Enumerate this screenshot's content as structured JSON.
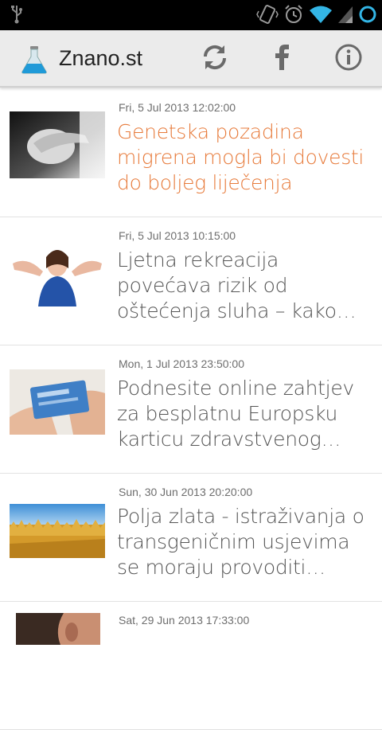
{
  "app": {
    "title": "Znano.st"
  },
  "toolbar": {
    "refresh_icon": "refresh-icon",
    "facebook_icon": "facebook-icon",
    "info_icon": "info-icon"
  },
  "status": {
    "usb_icon": "usb-icon",
    "accent": "#33b5e5"
  },
  "colors": {
    "active_title": "#e77a3a",
    "title": "#555555",
    "date": "#6e6e6e"
  },
  "articles": [
    {
      "date": "Fri, 5 Jul 2013 12:02:00",
      "title": "Genetska pozadina migrena mogla bi dovesti do boljeg liječenja"
    },
    {
      "date": "Fri, 5 Jul 2013 10:15:00",
      "title": "Ljetna rekreacija povećava rizik od oštećenja sluha – kako s…"
    },
    {
      "date": "Mon, 1 Jul 2013 23:50:00",
      "title": "Podnesite online zahtjev za besplatnu Europsku karticu zdravstvenog…"
    },
    {
      "date": "Sun, 30 Jun 2013 20:20:00",
      "title": "Polja zlata - istraživanja o transgeničnim usjevima se moraju provoditi van…"
    },
    {
      "date": "Sat, 29 Jun 2013 17:33:00",
      "title": ""
    }
  ]
}
